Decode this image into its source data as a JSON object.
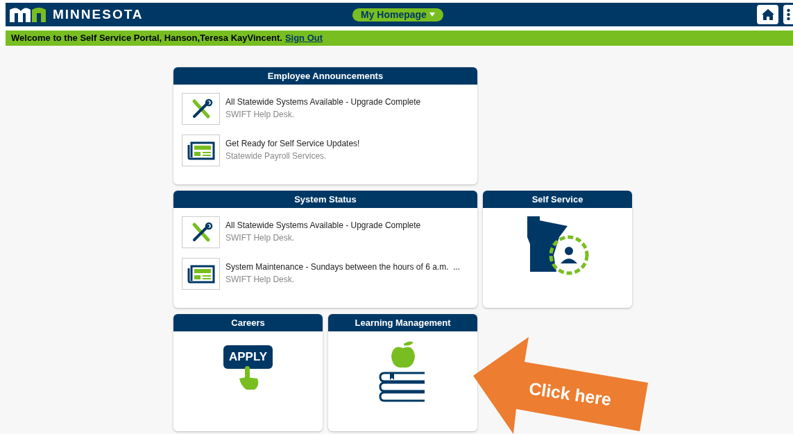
{
  "header": {
    "logo_text": "MINNESOTA",
    "page_menu": "My Homepage"
  },
  "welcome": {
    "text": "Welcome to the Self Service Portal, Hanson,Teresa KayVincent.",
    "link": "Sign Out"
  },
  "tiles": [
    {
      "kind": "list",
      "title": "Employee Announcements",
      "items": [
        {
          "kind": "tools",
          "title": "All Statewide Systems Available - Upgrade Complete",
          "source": "SWIFT Help Desk."
        },
        {
          "kind": "news",
          "title": "Get Ready for Self Service Updates!",
          "source": "Statewide Payroll Services."
        }
      ]
    },
    {
      "kind": "list",
      "title": "System Status",
      "items": [
        {
          "kind": "tools",
          "title": "All Statewide Systems Available - Upgrade Complete",
          "source": "SWIFT Help Desk."
        },
        {
          "kind": "news",
          "title": "System Maintenance - Sundays between the hours of 6 a.m.  ...",
          "source": "SWIFT Help Desk."
        }
      ]
    },
    {
      "kind": "state",
      "title": "Self Service"
    },
    {
      "kind": "apply",
      "title": "Careers",
      "art_text": "APPLY"
    },
    {
      "kind": "books",
      "title": "Learning Management"
    }
  ],
  "callout": {
    "text": "Click here"
  }
}
